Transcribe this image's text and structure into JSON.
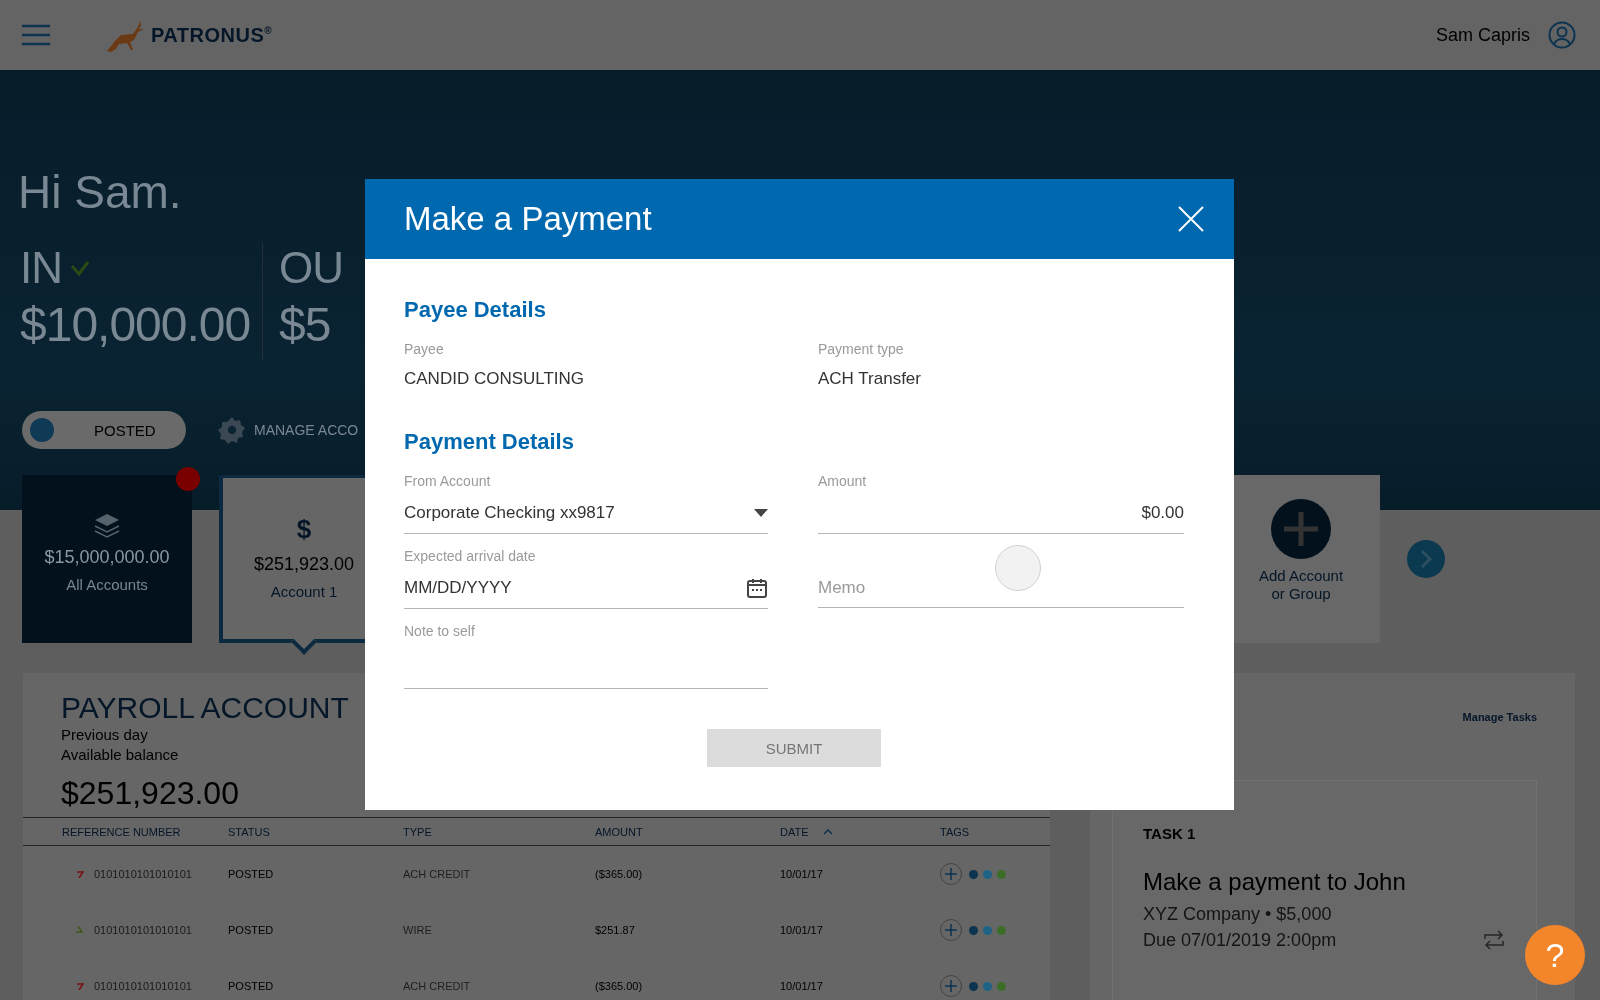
{
  "header": {
    "brand": "PATRONUS$^{®}$",
    "user_name": "Sam Capris"
  },
  "hero": {
    "greeting": "Hi Sam.",
    "in_label": "IN",
    "in_amount": "$10,000.00",
    "out_label": "OU",
    "out_amount": "$5",
    "toggle": {
      "label": "POSTED",
      "on": true
    },
    "manage_label": "MANAGE ACCO"
  },
  "account_cards": [
    {
      "kind": "all",
      "amount": "$15,000,000.00",
      "label": "All Accounts",
      "selected": false,
      "alert": true
    },
    {
      "kind": "account",
      "icon_text": "$",
      "amount": "$251,923.00",
      "label": "Account 1",
      "selected": true
    }
  ],
  "add_account": {
    "label": "Add Account or Group"
  },
  "payroll": {
    "title": "PAYROLL ACCOUNT",
    "subtitle": [
      "Previous day",
      "Available balance"
    ],
    "balance": "$251,923.00",
    "columns": [
      {
        "label": "REFERENCE NUMBER",
        "sorted": false
      },
      {
        "label": "STATUS",
        "sorted": false
      },
      {
        "label": "TYPE",
        "sorted": false
      },
      {
        "label": "AMOUNT",
        "sorted": false
      },
      {
        "label": "DATE",
        "sorted": true
      },
      {
        "label": "TAGS",
        "sorted": false
      }
    ],
    "rows": [
      {
        "kind": "debit",
        "reference": "0101010101010101",
        "status": "POSTED",
        "type": "ACH CREDIT",
        "amount": "($365.00)",
        "date": "10/01/17",
        "tags": [
          {
            "color": "#0c3350"
          },
          {
            "color": "#1d6486"
          },
          {
            "color": "#3b6e26"
          }
        ]
      },
      {
        "kind": "credit",
        "reference": "0101010101010101",
        "status": "POSTED",
        "type": "WIRE",
        "amount": "$251.87",
        "date": "10/01/17",
        "tags": [
          {
            "color": "#0c3350"
          },
          {
            "color": "#1d6486"
          },
          {
            "color": "#3b6e26"
          }
        ]
      },
      {
        "kind": "debit",
        "reference": "0101010101010101",
        "status": "POSTED",
        "type": "ACH CREDIT",
        "amount": "($365.00)",
        "date": "10/01/17",
        "tags": [
          {
            "color": "#0c3350"
          },
          {
            "color": "#1d6486"
          },
          {
            "color": "#3b6e26"
          }
        ]
      }
    ]
  },
  "tasks": {
    "manage_link": "Manage Tasks",
    "task": {
      "label": "TASK 1",
      "title": "Make a payment to John",
      "detail": "XYZ Company • $5,000",
      "due": "Due 07/01/2019 2:00pm"
    }
  },
  "modal": {
    "title": "Make a Payment",
    "sections": [
      {
        "heading": "Payee Details",
        "fields": [
          {
            "kind": "static",
            "label": "Payee",
            "value": "CANDID CONSULTING"
          },
          {
            "kind": "static",
            "label": "Payment type",
            "value": "ACH Transfer"
          }
        ]
      },
      {
        "heading": "Payment Details",
        "fields": [
          {
            "kind": "select",
            "label": "From Account",
            "value": "Corporate Checking xx9817"
          },
          {
            "kind": "amount",
            "label": "Amount",
            "value": "$0.00"
          },
          {
            "kind": "date",
            "label": "Expected arrival date",
            "value": "MM/DD/YYYY"
          },
          {
            "kind": "text",
            "placeholder": "Memo"
          },
          {
            "kind": "text",
            "label": "Note to self"
          }
        ]
      }
    ],
    "submit": {
      "label": "SUBMIT",
      "disabled": true
    }
  },
  "help_button": {
    "label": "?"
  }
}
